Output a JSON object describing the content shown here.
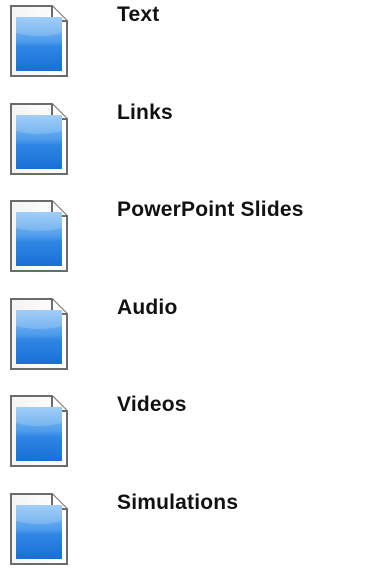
{
  "items": [
    {
      "label": "Text",
      "icon": "document-icon"
    },
    {
      "label": "Links",
      "icon": "document-icon"
    },
    {
      "label": "PowerPoint Slides",
      "icon": "document-icon"
    },
    {
      "label": "Audio",
      "icon": "document-icon"
    },
    {
      "label": "Videos",
      "icon": "document-icon"
    },
    {
      "label": "Simulations",
      "icon": "document-icon"
    }
  ],
  "colors": {
    "icon_blue_light": "#6fb2f2",
    "icon_blue_dark": "#1a6fd6",
    "icon_border": "#6b6b6b",
    "label_text": "#111111"
  }
}
